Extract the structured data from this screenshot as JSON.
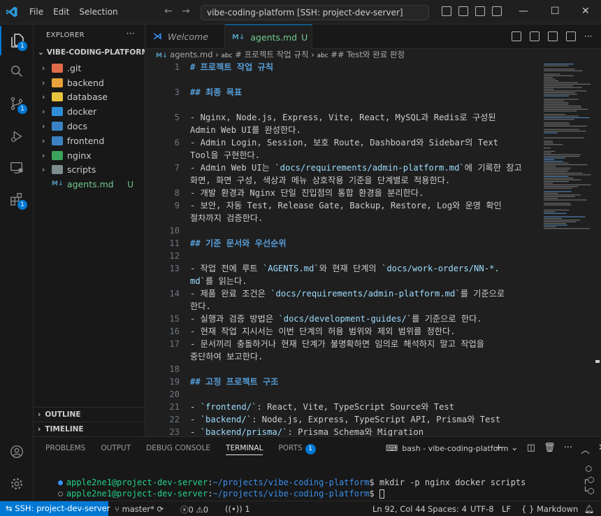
{
  "titlebar": {
    "menu": [
      "File",
      "Edit",
      "Selection"
    ],
    "command_center": "vibe-coding-platform [SSH: project-dev-server]"
  },
  "activity_bar": {
    "items": [
      {
        "name": "explorer",
        "badge": "1"
      },
      {
        "name": "search",
        "badge": ""
      },
      {
        "name": "source-control",
        "badge": "1"
      },
      {
        "name": "run-debug",
        "badge": ""
      },
      {
        "name": "remote-explorer",
        "badge": ""
      },
      {
        "name": "extensions",
        "badge": "1"
      }
    ]
  },
  "explorer": {
    "title": "EXPLORER",
    "root": "VIBE-CODING-PLATFORM ...",
    "items": [
      {
        "label": ".git",
        "type": "folder",
        "color": "#e06c4c"
      },
      {
        "label": "backend",
        "type": "folder",
        "color": "#e8a33d"
      },
      {
        "label": "database",
        "type": "folder",
        "color": "#e8c33d"
      },
      {
        "label": "docker",
        "type": "folder",
        "color": "#2f8fd6"
      },
      {
        "label": "docs",
        "type": "folder",
        "color": "#3b82c4"
      },
      {
        "label": "frontend",
        "type": "folder",
        "color": "#3b82c4"
      },
      {
        "label": "nginx",
        "type": "folder",
        "color": "#3ba55c"
      },
      {
        "label": "scripts",
        "type": "folder",
        "color": "#7f8c8d"
      },
      {
        "label": "agents.md",
        "type": "file",
        "status": "U"
      }
    ],
    "sections": [
      "OUTLINE",
      "TIMELINE"
    ]
  },
  "tabs": [
    {
      "label": "Welcome",
      "italic": true
    },
    {
      "label": "agents.md",
      "status": "U",
      "active": true
    }
  ],
  "breadcrumbs": [
    "agents.md",
    "# 프로젝트 작업 규칙",
    "## Test와 완료 판정"
  ],
  "editor": {
    "lines": [
      {
        "n": "1",
        "parts": [
          {
            "t": "# 프로젝트 작업 규칙",
            "c": "h"
          }
        ]
      },
      {
        "n": "",
        "parts": []
      },
      {
        "n": "3",
        "parts": [
          {
            "t": "## 최종 목표",
            "c": "h"
          }
        ]
      },
      {
        "n": "",
        "parts": []
      },
      {
        "n": "5",
        "parts": [
          {
            "t": "- Nginx, Node.js, Express, Vite, React, MySQL과 Redis로 구성된",
            "c": ""
          }
        ]
      },
      {
        "n": "",
        "parts": [
          {
            "t": "Admin Web UI를 완성한다.",
            "c": ""
          }
        ]
      },
      {
        "n": "6",
        "parts": [
          {
            "t": "- Admin Login, Session, 보호 Route, Dashboard와 Sidebar의 Text",
            "c": ""
          }
        ]
      },
      {
        "n": "",
        "parts": [
          {
            "t": "Tool을 구현한다.",
            "c": ""
          }
        ]
      },
      {
        "n": "7",
        "parts": [
          {
            "t": "- Admin Web UI는 ",
            "c": ""
          },
          {
            "t": "`docs/requirements/admin-platform.md`",
            "c": "ic2"
          },
          {
            "t": "에 기록한 참고",
            "c": ""
          }
        ]
      },
      {
        "n": "",
        "parts": [
          {
            "t": "화면, 화면 구성, 색상과 메뉴 상호작용 기준을 단계별로 적용한다.",
            "c": ""
          }
        ]
      },
      {
        "n": "8",
        "parts": [
          {
            "t": "- 개발 환경과 Nginx 단일 진입점의 통합 환경을 분리한다.",
            "c": ""
          }
        ]
      },
      {
        "n": "9",
        "parts": [
          {
            "t": "- 보안, 자동 Test, Release Gate, Backup, Restore, Log와 운영 확인",
            "c": ""
          }
        ]
      },
      {
        "n": "",
        "parts": [
          {
            "t": "절차까지 검증한다.",
            "c": ""
          }
        ]
      },
      {
        "n": "10",
        "parts": []
      },
      {
        "n": "11",
        "parts": [
          {
            "t": "## 기준 문서와 우선순위",
            "c": "h"
          }
        ]
      },
      {
        "n": "12",
        "parts": []
      },
      {
        "n": "13",
        "parts": [
          {
            "t": "- 작업 전에 루트 ",
            "c": ""
          },
          {
            "t": "`AGENTS.md`",
            "c": "ic2"
          },
          {
            "t": "와 현재 단계의 ",
            "c": ""
          },
          {
            "t": "`docs/work-orders/NN-*.",
            "c": "ic2"
          }
        ]
      },
      {
        "n": "",
        "parts": [
          {
            "t": "md`",
            "c": "ic2"
          },
          {
            "t": "를 읽는다.",
            "c": ""
          }
        ]
      },
      {
        "n": "14",
        "parts": [
          {
            "t": "- 제품 완료 조건은 ",
            "c": ""
          },
          {
            "t": "`docs/requirements/admin-platform.md`",
            "c": "ic2"
          },
          {
            "t": "를 기준으로",
            "c": ""
          }
        ]
      },
      {
        "n": "",
        "parts": [
          {
            "t": "한다.",
            "c": ""
          }
        ]
      },
      {
        "n": "15",
        "parts": [
          {
            "t": "- 실행과 검증 방법은 ",
            "c": ""
          },
          {
            "t": "`docs/development-guides/`",
            "c": "ic2"
          },
          {
            "t": "를 기준으로 한다.",
            "c": ""
          }
        ]
      },
      {
        "n": "16",
        "parts": [
          {
            "t": "- 현재 작업 지시서는 이번 단계의 허용 범위와 제외 범위를 정한다.",
            "c": ""
          }
        ]
      },
      {
        "n": "17",
        "parts": [
          {
            "t": "- 문서끼리 충돌하거나 현재 단계가 불명확하면 임의로 해석하지 말고 작업을",
            "c": ""
          }
        ]
      },
      {
        "n": "",
        "parts": [
          {
            "t": "중단하여 보고한다.",
            "c": ""
          }
        ]
      },
      {
        "n": "18",
        "parts": []
      },
      {
        "n": "19",
        "parts": [
          {
            "t": "## 고정 프로젝트 구조",
            "c": "h"
          }
        ]
      },
      {
        "n": "20",
        "parts": []
      },
      {
        "n": "21",
        "parts": [
          {
            "t": "- ",
            "c": ""
          },
          {
            "t": "`frontend/`",
            "c": "ic2"
          },
          {
            "t": ": React, Vite, TypeScript Source와 Test",
            "c": ""
          }
        ]
      },
      {
        "n": "22",
        "parts": [
          {
            "t": "- ",
            "c": ""
          },
          {
            "t": "`backend/`",
            "c": "ic2"
          },
          {
            "t": ": Node.js, Express, TypeScript API, Prisma와 Test",
            "c": ""
          }
        ]
      },
      {
        "n": "23",
        "parts": [
          {
            "t": "- ",
            "c": ""
          },
          {
            "t": "`backend/prisma/`",
            "c": "ic2"
          },
          {
            "t": ": Prisma Schema와 Migration",
            "c": ""
          }
        ]
      }
    ]
  },
  "panel": {
    "tabs": [
      "PROBLEMS",
      "OUTPUT",
      "DEBUG CONSOLE",
      "TERMINAL",
      "PORTS"
    ],
    "active_tab": "TERMINAL",
    "ports_badge": "1",
    "terminal_name": "bash - vibe-coding-platform",
    "lines": [
      {
        "user": "apple2ne1@project-dev-server",
        "sep": ":",
        "path": "~/projects/vibe-coding-platform",
        "prompt": "$ ",
        "cmd": "mkdir -p nginx docker scripts",
        "dot": "#3794ff"
      },
      {
        "user": "apple2ne1@project-dev-server",
        "sep": ":",
        "path": "~/projects/vibe-coding-platform",
        "prompt": "$ ",
        "cmd": "",
        "dot": "#8b8b8b"
      }
    ]
  },
  "statusbar": {
    "remote": "SSH: project-dev-server",
    "branch": "master*",
    "errors": "0",
    "warnings": "0",
    "ports": "1",
    "position": "Ln 92, Col 44",
    "spaces": "Spaces: 4",
    "encoding": "UTF-8",
    "eol": "LF",
    "language": "Markdown"
  }
}
